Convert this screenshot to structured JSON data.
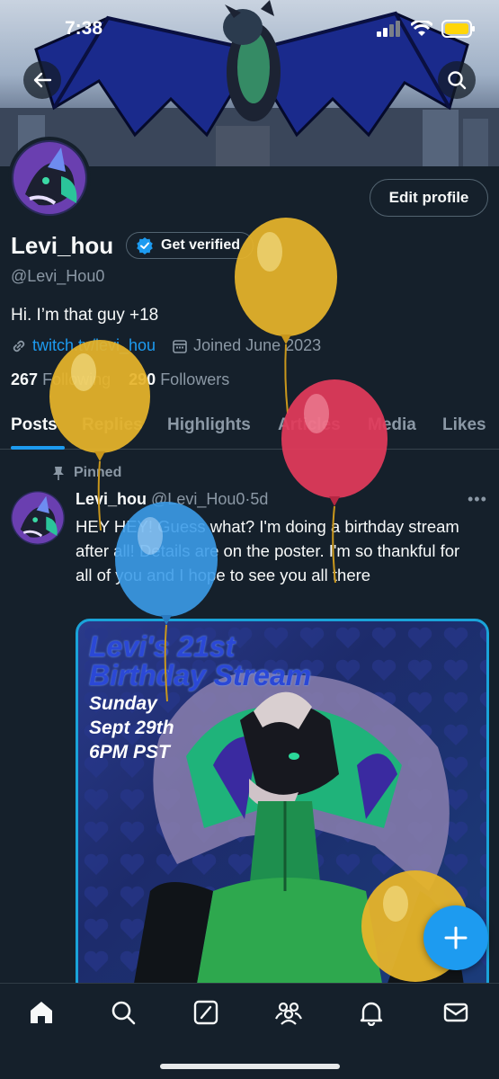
{
  "status_bar": {
    "time": "7:38"
  },
  "header": {
    "back_icon": "arrow-left-icon",
    "search_icon": "search-icon"
  },
  "profile": {
    "edit_label": "Edit profile",
    "display_name": "Levi_hou",
    "verify_label": "Get verified",
    "handle": "@Levi_Hou0",
    "bio": "Hi. I’m that guy +18",
    "link": "twitch.tv/levi_hou",
    "joined": "Joined June 2023",
    "following_count": "267",
    "following_label": "Following",
    "followers_count": "290",
    "followers_label": "Followers"
  },
  "tabs": [
    "Posts",
    "Replies",
    "Highlights",
    "Articles",
    "Media",
    "Likes"
  ],
  "post": {
    "pinned_label": "Pinned",
    "author_name": "Levi_hou",
    "author_handle": "@Levi_Hou0",
    "separator": "·",
    "age": "5d",
    "text": "HEY HEY! Guess what? I'm doing a birthday stream after all! Details are on the poster. I'm so thankful for all of you and I hope to see you all there",
    "poster_title_1": "Levi's 21st",
    "poster_title_2": "Birthday Stream",
    "poster_day": "Sunday",
    "poster_date": "Sept 29th",
    "poster_time": "6PM PST"
  },
  "bottom_nav": [
    "home-icon",
    "search-icon",
    "grok-icon",
    "communities-icon",
    "notifications-icon",
    "messages-icon"
  ],
  "colors": {
    "accent": "#1d9bf0",
    "background": "#15202b",
    "secondary_text": "#8b98a5",
    "balloon_yellow": "#e6b42a",
    "balloon_red": "#e23a5a",
    "balloon_blue": "#3b9be8"
  }
}
